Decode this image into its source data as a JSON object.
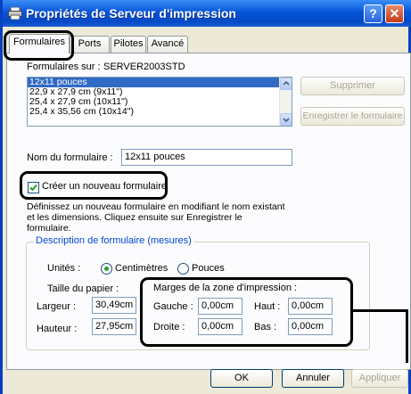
{
  "window": {
    "title": "Propriétés de Serveur d'impression",
    "help_label": "?",
    "close_label": "✕"
  },
  "tabs": [
    {
      "label": "Formulaires",
      "active": true
    },
    {
      "label": "Ports",
      "active": false
    },
    {
      "label": "Pilotes",
      "active": false
    },
    {
      "label": "Avancé",
      "active": false
    }
  ],
  "forms": {
    "server_label": "Formulaires sur :",
    "server_name": "SERVER2003STD",
    "list": [
      {
        "label": "12x11 pouces",
        "selected": true
      },
      {
        "label": "22,9 x 27,9 cm (9x11\")",
        "selected": false
      },
      {
        "label": "25,4 x 27,9 cm (10x11\")",
        "selected": false
      },
      {
        "label": "25,4 x 35,56 cm (10x14\")",
        "selected": false
      }
    ],
    "delete_button": "Supprimer",
    "save_button": "Enregistrer le formulaire",
    "name_label": "Nom du formulaire :",
    "name_value": "12x11 pouces",
    "create_checkbox_label": "Créer un nouveau formulaire",
    "create_checked": true,
    "description": "Définissez un nouveau formulaire en modifiant le nom existant et les dimensions. Cliquez ensuite sur Enregistrer le formulaire."
  },
  "measurements": {
    "group_title": "Description de formulaire (mesures)",
    "units_label": "Unités :",
    "unit_cm": "Centimètres",
    "unit_in": "Pouces",
    "selected_unit": "cm",
    "paper_size_label": "Taille du papier :",
    "width_label": "Largeur :",
    "width_value": "30,49cm",
    "height_label": "Hauteur :",
    "height_value": "27,95cm",
    "margins_title": "Marges de la zone d'impression :",
    "left_label": "Gauche :",
    "left_value": "0,00cm",
    "top_label": "Haut :",
    "top_value": "0,00cm",
    "right_label": "Droite :",
    "right_value": "0,00cm",
    "bottom_label": "Bas :",
    "bottom_value": "0,00cm"
  },
  "footer": {
    "ok": "OK",
    "cancel": "Annuler",
    "apply": "Appliquer"
  },
  "colors": {
    "titlebar": "#0549c5",
    "dialog_bg": "#ece9d8",
    "selection": "#316ac5",
    "group_title": "#0046d5"
  }
}
